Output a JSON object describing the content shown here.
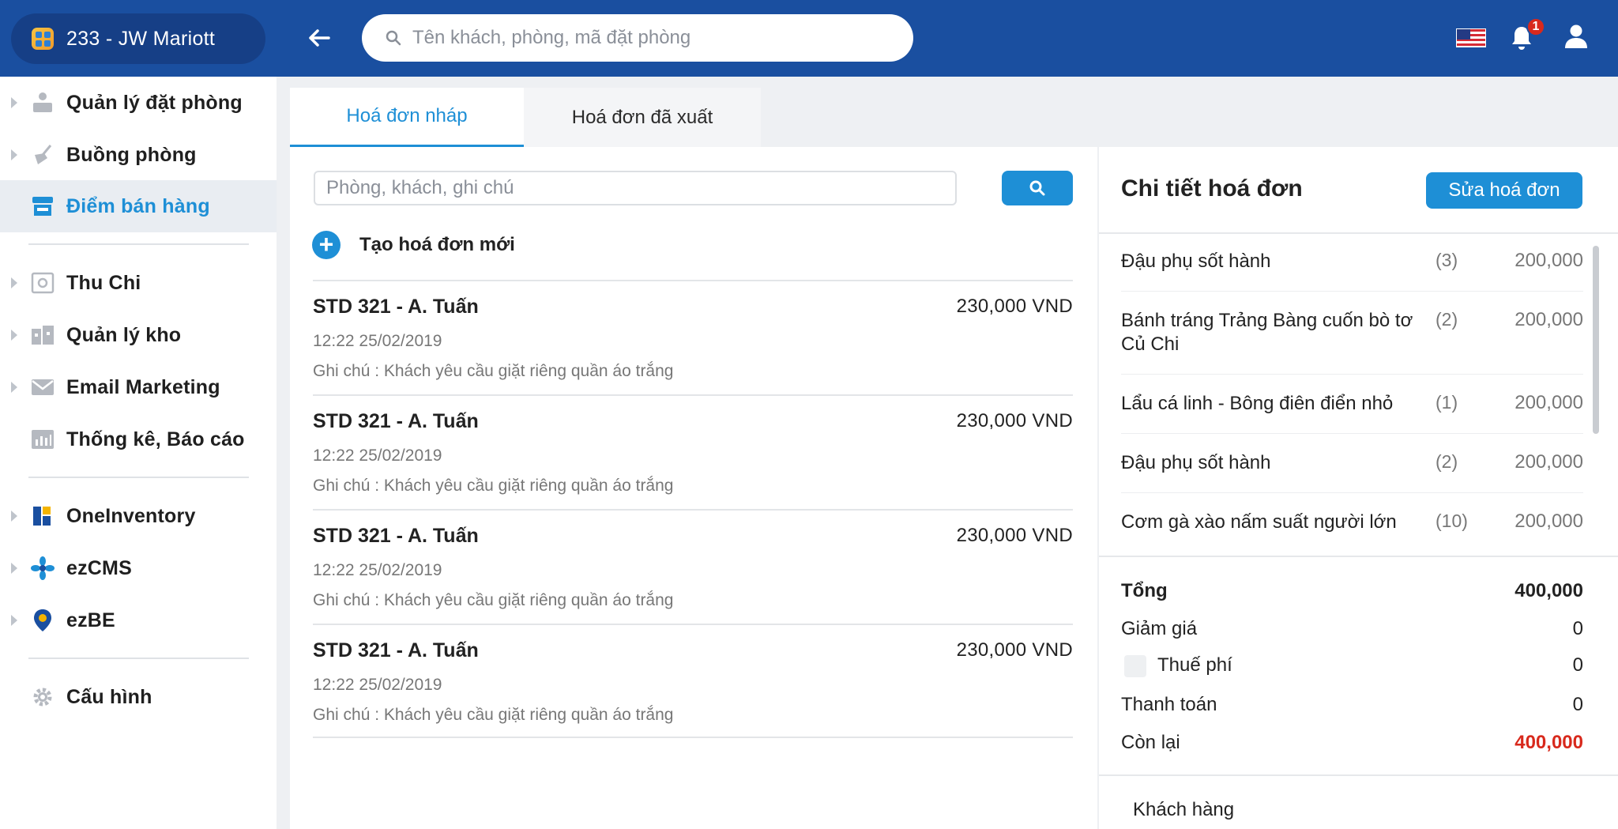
{
  "header": {
    "hotel_name": "233 - JW Mariott",
    "search_placeholder": "Tên khách, phòng, mã đặt phòng",
    "notification_count": "1",
    "language_flag": "us-flag-icon"
  },
  "sidebar": {
    "items": [
      {
        "label": "Quản lý đặt phòng",
        "icon": "booking-icon"
      },
      {
        "label": "Buồng phòng",
        "icon": "housekeeping-icon"
      },
      {
        "label": "Điểm bán hàng",
        "icon": "store-icon",
        "active": true
      },
      {
        "label": "Thu Chi",
        "icon": "safe-icon"
      },
      {
        "label": "Quản lý kho",
        "icon": "warehouse-icon"
      },
      {
        "label": "Email Marketing",
        "icon": "mail-icon"
      },
      {
        "label": "Thống kê, Báo cáo",
        "icon": "report-icon"
      },
      {
        "label": "OneInventory",
        "icon": "oneinventory-icon"
      },
      {
        "label": "ezCMS",
        "icon": "ezcms-icon"
      },
      {
        "label": "ezBE",
        "icon": "ezbe-icon"
      },
      {
        "label": "Cấu hình",
        "icon": "gear-icon"
      }
    ]
  },
  "tabs": {
    "draft": "Hoá đơn nháp",
    "exported": "Hoá đơn đã xuất"
  },
  "list": {
    "search_placeholder": "Phòng, khách, ghi chú",
    "create_label": "Tạo hoá đơn mới",
    "invoices": [
      {
        "name": "STD 321 - A. Tuấn",
        "amount": "230,000 VND",
        "time": "12:22 25/02/2019",
        "note": "Ghi chú : Khách yêu cầu giặt riêng quần áo trắng"
      },
      {
        "name": "STD 321 - A. Tuấn",
        "amount": "230,000 VND",
        "time": "12:22 25/02/2019",
        "note": "Ghi chú : Khách yêu cầu giặt riêng quần áo trắng"
      },
      {
        "name": "STD 321 - A. Tuấn",
        "amount": "230,000 VND",
        "time": "12:22 25/02/2019",
        "note": "Ghi chú : Khách yêu cầu giặt riêng quần áo trắng"
      },
      {
        "name": "STD 321 - A. Tuấn",
        "amount": "230,000 VND",
        "time": "12:22 25/02/2019",
        "note": "Ghi chú : Khách yêu cầu giặt riêng quần áo trắng"
      }
    ]
  },
  "detail": {
    "title": "Chi tiết hoá đơn",
    "edit_label": "Sửa hoá đơn",
    "items": [
      {
        "name": "Đậu phụ sốt hành",
        "qty": "(3)",
        "price": "200,000"
      },
      {
        "name": "Bánh tráng Trảng Bàng cuốn bò tơ Củ Chi",
        "qty": "(2)",
        "price": "200,000"
      },
      {
        "name": "Lẩu cá linh - Bông điên điển nhỏ",
        "qty": "(1)",
        "price": "200,000"
      },
      {
        "name": "Đậu phụ sốt hành",
        "qty": "(2)",
        "price": "200,000"
      },
      {
        "name": "Cơm gà xào nấm suất người lớn",
        "qty": "(10)",
        "price": "200,000"
      }
    ],
    "summary": {
      "total_label": "Tổng",
      "total_value": "400,000",
      "discount_label": "Giảm giá",
      "discount_value": "0",
      "tax_label": "Thuế phí",
      "tax_value": "0",
      "paid_label": "Thanh toán",
      "paid_value": "0",
      "remaining_label": "Còn lại",
      "remaining_value": "400,000"
    },
    "customer_label": "Khách hàng"
  },
  "colors": {
    "topbar": "#1a4fa0",
    "accent": "#1e8fd6",
    "danger": "#d8291c"
  }
}
